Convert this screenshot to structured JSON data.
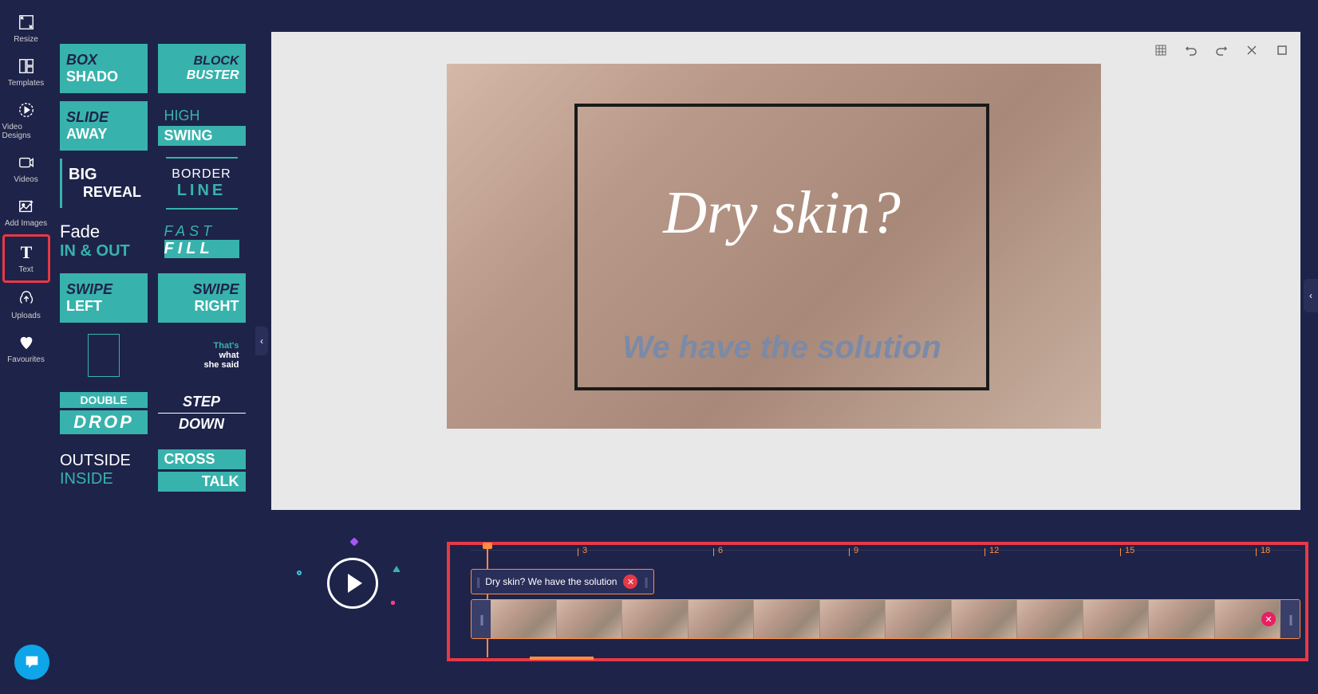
{
  "sidebar": {
    "items": [
      {
        "label": "Resize",
        "icon": "resize-icon"
      },
      {
        "label": "Templates",
        "icon": "templates-icon"
      },
      {
        "label": "Video Designs",
        "icon": "video-designs-icon"
      },
      {
        "label": "Videos",
        "icon": "videos-icon"
      },
      {
        "label": "Add Images",
        "icon": "add-images-icon"
      },
      {
        "label": "Text",
        "icon": "text-icon"
      },
      {
        "label": "Uploads",
        "icon": "uploads-icon"
      },
      {
        "label": "",
        "icon": "favourites-icon"
      },
      {
        "label": "Favourites",
        "icon": ""
      }
    ],
    "resize": "Resize",
    "templates": "Templates",
    "video_designs": "Video Designs",
    "videos": "Videos",
    "add_images": "Add Images",
    "text": "Text",
    "uploads": "Uploads",
    "favourites": "Favourites"
  },
  "text_options": [
    {
      "line1": "BOX",
      "line2": "SHADO"
    },
    {
      "line1": "BLOCK",
      "line2": "BUSTER"
    },
    {
      "line1": "SLIDE",
      "line2": "AWAY"
    },
    {
      "line1": "HIGH",
      "line2": "SWING"
    },
    {
      "line1": "BIG",
      "line2": "REVEAL"
    },
    {
      "line1": "BORDER",
      "line2": "LINE"
    },
    {
      "line1": "Fade",
      "line2": "IN & OUT"
    },
    {
      "line1": "FAST",
      "line2": "FILL"
    },
    {
      "line1": "SWIPE",
      "line2": "LEFT"
    },
    {
      "line1": "SWIPE",
      "line2": "RIGHT"
    },
    {
      "line1": "",
      "line2": ""
    },
    {
      "line1": "That's",
      "line2": "what",
      "line3": "she said"
    },
    {
      "line1": "DOUBLE",
      "line2": "DROP"
    },
    {
      "line1": "STEP",
      "line2": "DOWN"
    },
    {
      "line1": "OUTSIDE",
      "line2": "INSIDE"
    },
    {
      "line1": "CROSS",
      "line2": "TALK"
    }
  ],
  "canvas": {
    "headline": "Dry skin?",
    "subline": "We have the solution"
  },
  "timeline": {
    "ruler_marks": [
      "3",
      "6",
      "9",
      "12",
      "15",
      "18"
    ],
    "text_clip_label": "Dry skin? We have the solution",
    "thumbnail_count": 12
  },
  "colors": {
    "bg": "#1e2349",
    "accent_teal": "#38b2ac",
    "highlight_red": "#e63946",
    "timeline_orange": "#ff8c42"
  }
}
